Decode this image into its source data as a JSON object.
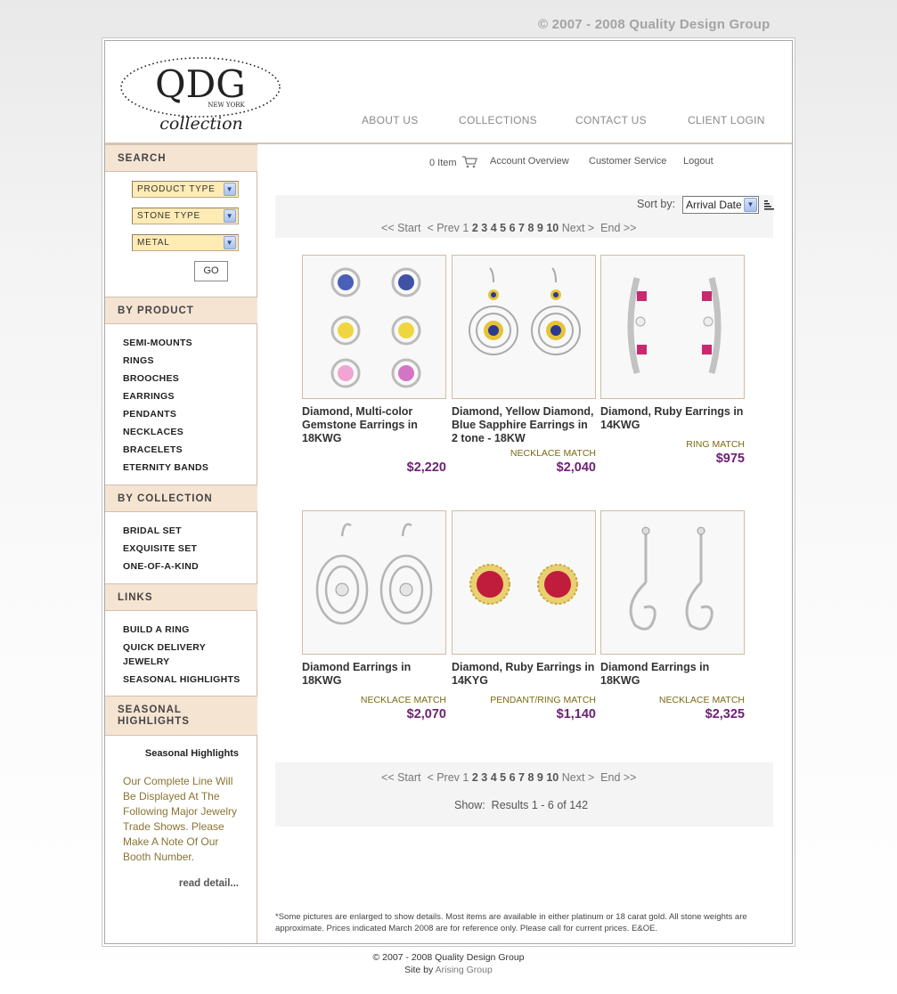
{
  "top_copyright": "© 2007 - 2008 Quality Design Group",
  "brand": {
    "logo_main": "QDG",
    "logo_sub": "NEW YORK",
    "logo_script": "collection"
  },
  "topnav": [
    {
      "id": "about",
      "label": "ABOUT US"
    },
    {
      "id": "collections",
      "label": "COLLECTIONS"
    },
    {
      "id": "contact",
      "label": "CONTACT US"
    },
    {
      "id": "client-login",
      "label": "CLIENT LOGIN"
    }
  ],
  "sidebar": {
    "search_heading": "SEARCH",
    "dropdowns": [
      "PRODUCT TYPE",
      "STONE TYPE",
      "METAL"
    ],
    "go_label": "GO",
    "by_product_heading": "BY PRODUCT",
    "by_product": [
      "SEMI-MOUNTS",
      "RINGS",
      "BROOCHES",
      "EARRINGS",
      "PENDANTS",
      "NECKLACES",
      "BRACELETS",
      "ETERNITY BANDS"
    ],
    "by_collection_heading": "BY COLLECTION",
    "by_collection": [
      "BRIDAL SET",
      "EXQUISITE SET",
      "ONE-OF-A-KIND"
    ],
    "links_heading": "LINKS",
    "links": [
      "BUILD A RING",
      "QUICK DELIVERY",
      "JEWELRY",
      "SEASONAL HIGHLIGHTS"
    ],
    "seasonal_heading_line1": "SEASONAL",
    "seasonal_heading_line2": "HIGHLIGHTS",
    "seasonal_title": "Seasonal Highlights",
    "seasonal_text": "Our Complete Line Will Be Displayed At The Following Major Jewelry Trade Shows. Please Make A Note Of Our Booth Number.",
    "read_more": "read detail..."
  },
  "util": {
    "cart": "0 Item",
    "account": "Account Overview",
    "service": "Customer Service",
    "logout": "Logout"
  },
  "sort": {
    "label": "Sort by:",
    "selected": "Arrival Date"
  },
  "pager": {
    "start": "<< Start",
    "prev": "< Prev",
    "pages": [
      "1",
      "2",
      "3",
      "4",
      "5",
      "6",
      "7",
      "8",
      "9",
      "10"
    ],
    "next": "Next >",
    "end": "End >>"
  },
  "results": "Show:  Results 1 - 6 of 142",
  "products": [
    {
      "name": "Diamond, Multi-color Gemstone Earrings in 18KWG",
      "match": "",
      "price": "$2,220"
    },
    {
      "name": "Diamond, Yellow Diamond, Blue Sapphire Earrings in 2 tone - 18KW",
      "match": "NECKLACE MATCH",
      "price": "$2,040"
    },
    {
      "name": "Diamond, Ruby Earrings in 14KWG",
      "match": "RING MATCH",
      "price": "$975"
    },
    {
      "name": "Diamond Earrings in 18KWG",
      "match": "NECKLACE MATCH",
      "price": "$2,070"
    },
    {
      "name": "Diamond, Ruby Earrings in 14KYG",
      "match": "PENDANT/RING MATCH",
      "price": "$1,140"
    },
    {
      "name": "Diamond Earrings in 18KWG",
      "match": "NECKLACE MATCH",
      "price": "$2,325"
    }
  ],
  "footnote": "*Some pictures are enlarged to show details. Most items are available in either platinum or 18 carat gold. All stone weights are approximate. Prices indicated March 2008 are for reference only. Please call for current prices. E&OE.",
  "footer": {
    "copyright": "© 2007 - 2008 Quality Design Group",
    "site_by_prefix": "Site by ",
    "site_by_link": "Arising Group"
  },
  "colors": {
    "price": "#6e1f74",
    "match": "#7c6a12",
    "sidebar_head": "#f6e4d3",
    "dropdown": "#ffebb4"
  }
}
